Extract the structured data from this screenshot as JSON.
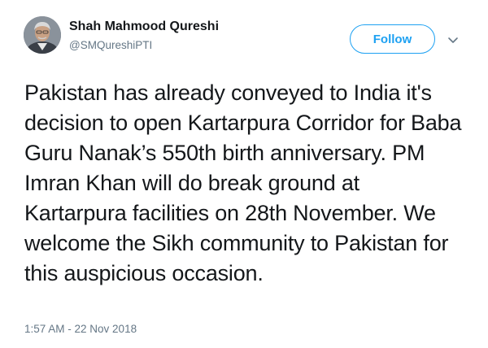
{
  "author": {
    "name": "Shah Mahmood Qureshi",
    "handle": "@SMQureshiPTI"
  },
  "follow_button": {
    "label": "Follow"
  },
  "menu": {
    "icon": "chevron-down-icon"
  },
  "tweet": {
    "lines": [
      "Pakistan has already conveyed to India it's",
      "decision to open Kartarpura Corridor for Baba",
      "Guru Nanak’s 550th birth anniversary. PM",
      "Imran Khan will do break ground at",
      "Kartarpura facilities on 28th November. We",
      "welcome the Sikh community to Pakistan for",
      "this auspicious occasion."
    ],
    "timestamp": "1:57 AM - 22 Nov 2018"
  },
  "colors": {
    "accent": "#1da1f2",
    "text": "#14171a",
    "secondary": "#657786"
  }
}
